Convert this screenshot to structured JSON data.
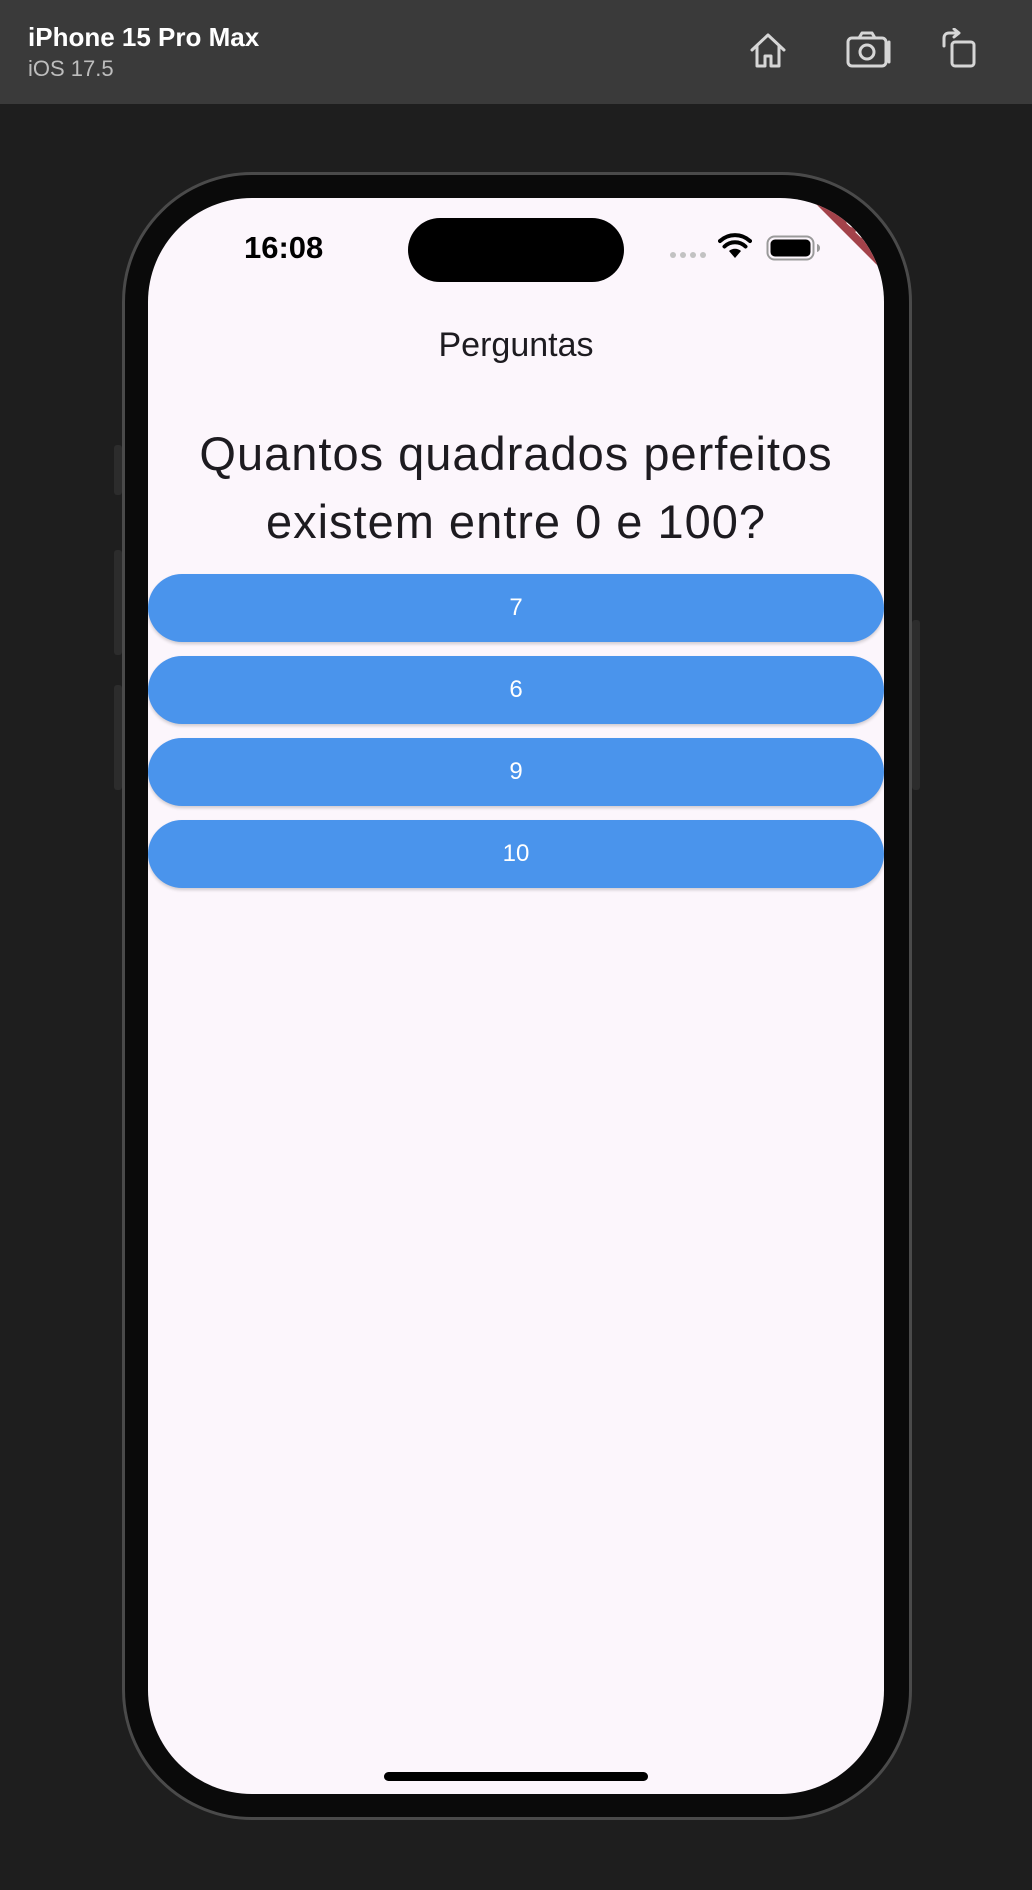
{
  "simulator": {
    "device_name": "iPhone 15 Pro Max",
    "os_version": "iOS 17.5",
    "toolbar_icons": [
      "home-icon",
      "screenshot-icon",
      "rotate-icon"
    ]
  },
  "status_bar": {
    "time": "16:08"
  },
  "debug_banner": "DEBUG",
  "app": {
    "title": "Perguntas",
    "question": "Quantos quadrados perfeitos existem entre 0 e 100?",
    "answers": [
      "7",
      "6",
      "9",
      "10"
    ]
  },
  "colors": {
    "answer_button": "#4a94ec",
    "background": "#fcf6fc",
    "debug_ribbon": "#a3424a"
  }
}
